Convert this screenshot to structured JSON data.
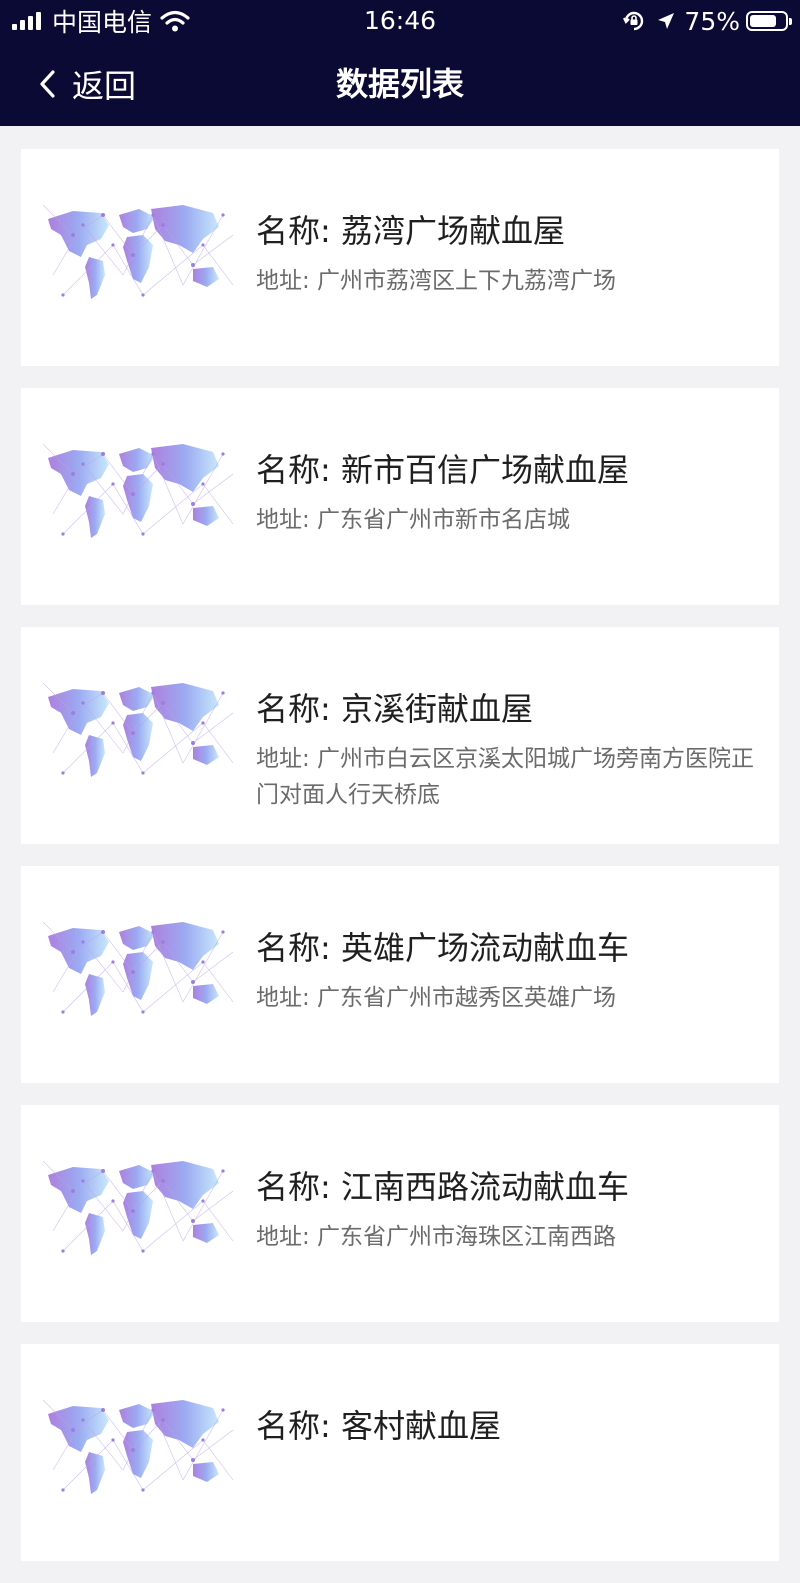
{
  "status_bar": {
    "carrier": "中国电信",
    "time": "16:46",
    "battery_percent": "75%",
    "battery_level": 0.75,
    "icons": [
      "signal-icon",
      "wifi-icon",
      "orientation-lock-icon",
      "location-arrow-icon",
      "battery-icon"
    ]
  },
  "nav": {
    "back_label": "返回",
    "back_icon": "chevron-left-icon",
    "title": "数据列表"
  },
  "colors": {
    "header_bg": "#0b0a34",
    "page_bg": "#f2f2f4",
    "card_bg": "#ffffff",
    "name_text": "#1f1f1f",
    "address_text": "#6b6b6b",
    "map_purple": "#a06ad8",
    "map_blue": "#7aaaf5"
  },
  "items": [
    {
      "name": "名称: 荔湾广场献血屋",
      "address": "地址: 广州市荔湾区上下九荔湾广场",
      "thumbnail": "world-map-image"
    },
    {
      "name": "名称: 新市百信广场献血屋",
      "address": "地址: 广东省广州市新市名店城",
      "thumbnail": "world-map-image"
    },
    {
      "name": "名称: 京溪街献血屋",
      "address": "地址: 广州市白云区京溪太阳城广场旁南方医院正门对面人行天桥底",
      "thumbnail": "world-map-image"
    },
    {
      "name": "名称: 英雄广场流动献血车",
      "address": "地址: 广东省广州市越秀区英雄广场",
      "thumbnail": "world-map-image"
    },
    {
      "name": "名称: 江南西路流动献血车",
      "address": "地址: 广东省广州市海珠区江南西路",
      "thumbnail": "world-map-image"
    },
    {
      "name": "名称: 客村献血屋",
      "address": "",
      "thumbnail": "world-map-image"
    }
  ]
}
